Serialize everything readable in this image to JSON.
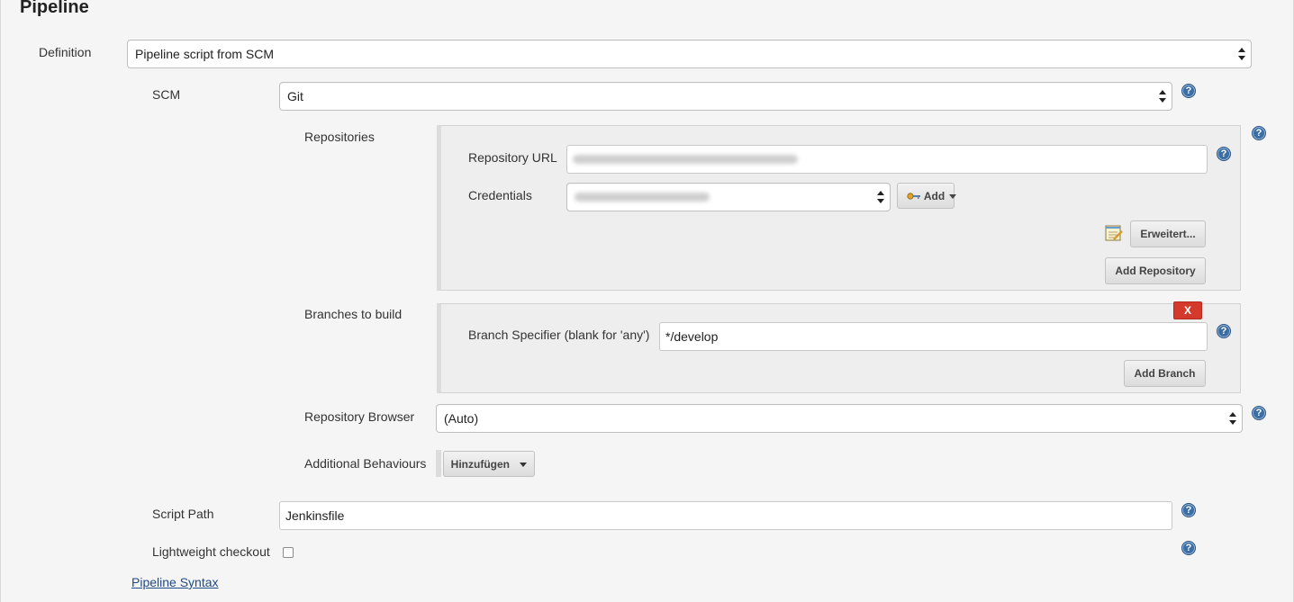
{
  "section": {
    "title": "Pipeline"
  },
  "definition": {
    "label": "Definition",
    "selected": "Pipeline script from SCM"
  },
  "scm": {
    "label": "SCM",
    "selected": "Git"
  },
  "repositories": {
    "label": "Repositories",
    "url_label": "Repository URL",
    "credentials_label": "Credentials",
    "add_credentials_label": "Add",
    "advanced_label": "Erweitert...",
    "add_repository_label": "Add Repository"
  },
  "branches": {
    "label": "Branches to build",
    "remove_label": "X",
    "specifier_label": "Branch Specifier (blank for 'any')",
    "specifier_value": "*/develop",
    "add_branch_label": "Add Branch"
  },
  "repository_browser": {
    "label": "Repository Browser",
    "selected": "(Auto)"
  },
  "additional_behaviours": {
    "label": "Additional Behaviours",
    "add_label": "Hinzufügen"
  },
  "script_path": {
    "label": "Script Path",
    "value": "Jenkinsfile"
  },
  "lightweight_checkout": {
    "label": "Lightweight checkout",
    "checked": false
  },
  "pipeline_syntax_link": "Pipeline Syntax",
  "help_glyph": "?",
  "colors": {
    "help": "#3a6ea5",
    "remove": "#d33a2c",
    "link": "#204a87"
  },
  "icons": [
    "help-icon",
    "key-icon",
    "notepad-icon",
    "select-arrows-icon",
    "caret-down-icon"
  ]
}
